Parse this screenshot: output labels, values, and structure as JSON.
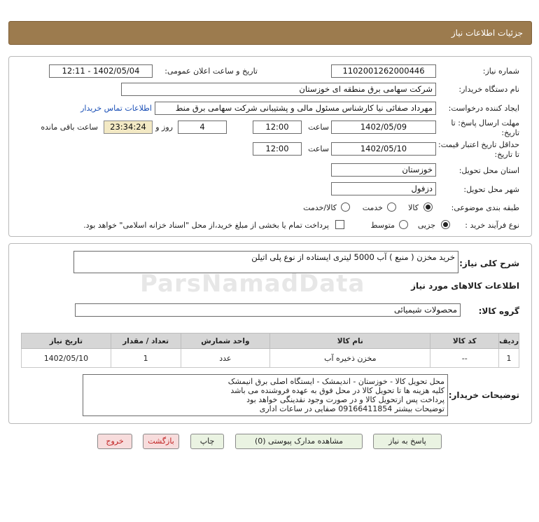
{
  "header": {
    "title": "جزئیات اطلاعات نیاز"
  },
  "form": {
    "need_number_label": "شماره نیاز:",
    "need_number": "1102001262000446",
    "announce_label": "تاریخ و ساعت اعلان عمومی:",
    "announce_value": "1402/05/04 - 12:11",
    "buyer_org_label": "نام دستگاه خریدار:",
    "buyer_org": "شرکت سهامی برق منطقه ای خوزستان",
    "creator_label": "ایجاد کننده درخواست:",
    "creator": "مهرداد صفائی نیا کارشناس مسئول مالی و پشتیبانی شرکت سهامی برق منط",
    "contact_link": "اطلاعات تماس خریدار",
    "reply_deadline_label": "مهلت ارسال پاسخ: تا تاریخ:",
    "reply_date": "1402/05/09",
    "time_label": "ساعت",
    "reply_time": "12:00",
    "days_value": "4",
    "days_label": "روز و",
    "remaining_time": "23:34:24",
    "remaining_label": "ساعت باقی مانده",
    "validity_label": "حداقل تاریخ اعتبار قیمت: تا تاریخ:",
    "validity_date": "1402/05/10",
    "validity_time": "12:00",
    "province_label": "استان محل تحویل:",
    "province": "خوزستان",
    "city_label": "شهر محل تحویل:",
    "city": "دزفول",
    "category_label": "طبقه بندی موضوعی:",
    "category_options": [
      "کالا",
      "خدمت",
      "کالا/خدمت"
    ],
    "process_label": "نوع فرآیند خرید :",
    "process_options": [
      "جزیی",
      "متوسط"
    ],
    "payment_note": "پرداخت تمام یا بخشی از مبلغ خرید،از محل \"اسناد خزانه اسلامی\" خواهد بود."
  },
  "details": {
    "summary_label": "شرح کلی نیاز:",
    "summary": "خرید مخزن ( منبع ) آب 5000 لیتری ایستاده از نوع پلی اتیلن",
    "goods_info_title": "اطلاعات کالاهای مورد نیاز",
    "goods_group_label": "گروه کالا:",
    "goods_group": "محصولات شیمیائی",
    "table": {
      "headers": [
        "ردیف",
        "کد کالا",
        "نام کالا",
        "واحد شمارش",
        "تعداد / مقدار",
        "تاریخ نیاز"
      ],
      "rows": [
        [
          "1",
          "--",
          "مخزن ذخیره آب",
          "عدد",
          "1",
          "1402/05/10"
        ]
      ]
    },
    "buyer_notes_label": "توضیحات خریدار:",
    "buyer_notes": [
      "محل تحویل کالا - خوزستان - اندیمشک - ایستگاه اصلی برق انیمشک",
      "کلیه هزینه ها تا تحویل کالا در محل فوق به عهده فروشنده می باشد",
      "پرداخت پس ازتحویل کالا و در صورت وجود نقدینگی خواهد بود",
      "توضیحات بیشتر 09166411854  صفایی در ساعات اداری"
    ]
  },
  "buttons": {
    "reply": "پاسخ به نیاز",
    "attachments": "مشاهده مدارک پیوستی (0)",
    "print": "چاپ",
    "back": "بازگشت",
    "exit": "خروج"
  },
  "watermark": "ParsNamadData"
}
